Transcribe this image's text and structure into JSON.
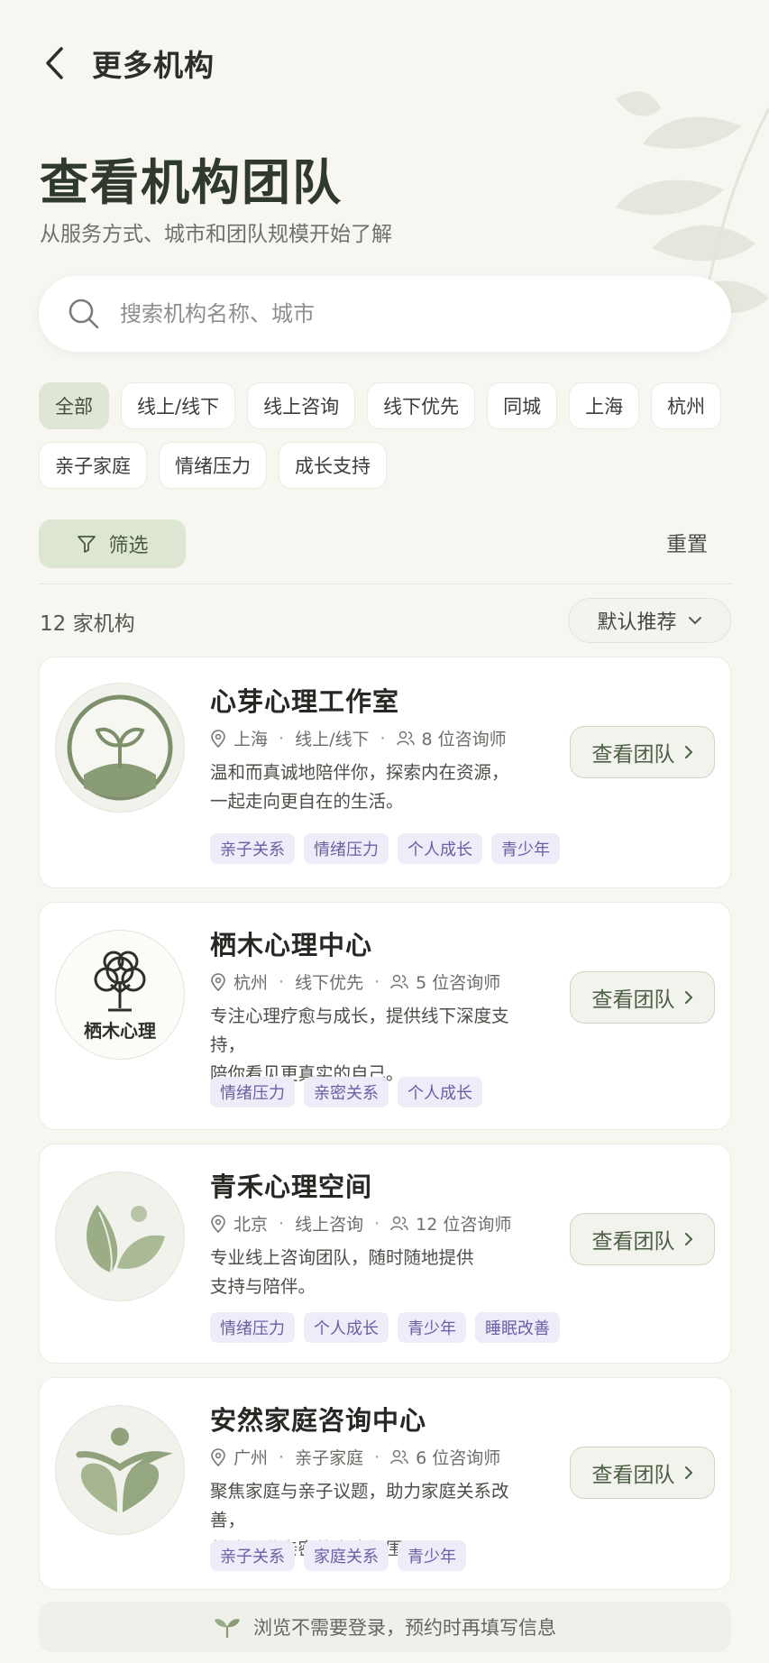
{
  "header": {
    "title": "更多机构"
  },
  "hero": {
    "title": "查看机构团队",
    "subtitle": "从服务方式、城市和团队规模开始了解"
  },
  "search": {
    "placeholder": "搜索机构名称、城市",
    "value": ""
  },
  "chips": [
    {
      "label": "全部",
      "active": true
    },
    {
      "label": "线上/线下"
    },
    {
      "label": "线上咨询"
    },
    {
      "label": "线下优先"
    },
    {
      "label": "同城"
    },
    {
      "label": "上海"
    },
    {
      "label": "杭州"
    },
    {
      "label": "亲子家庭"
    },
    {
      "label": "情绪压力"
    },
    {
      "label": "成长支持"
    }
  ],
  "filter": {
    "label": "筛选",
    "reset": "重置"
  },
  "results": {
    "count": "12 家机构",
    "sort": "默认推荐"
  },
  "orgs": [
    {
      "name": "心芽心理工作室",
      "city": "上海",
      "mode": "线上/线下",
      "counselors": "8 位咨询师",
      "desc": [
        "温和而真诚地陪伴你，探索内在资源，",
        "一起走向更自在的生活。"
      ],
      "tags": [
        "亲子关系",
        "情绪压力",
        "个人成长",
        "青少年"
      ],
      "button": "查看团队",
      "logo": "sprout-logo"
    },
    {
      "name": "栖木心理中心",
      "city": "杭州",
      "mode": "线下优先",
      "counselors": "5 位咨询师",
      "desc": [
        "专注心理疗愈与成长，提供线下深度支持，",
        "陪你看见更真实的自己。"
      ],
      "tags": [
        "情绪压力",
        "亲密关系",
        "个人成长"
      ],
      "button": "查看团队",
      "logo": "tree-logo",
      "logo_text": "栖木心理"
    },
    {
      "name": "青禾心理空间",
      "city": "北京",
      "mode": "线上咨询",
      "counselors": "12 位咨询师",
      "desc": [
        "专业线上咨询团队，随时随地提供",
        "支持与陪伴。"
      ],
      "tags": [
        "情绪压力",
        "个人成长",
        "青少年",
        "睡眠改善"
      ],
      "button": "查看团队",
      "logo": "leaf-logo"
    },
    {
      "name": "安然家庭咨询中心",
      "city": "广州",
      "mode": "亲子家庭",
      "counselors": "6 位咨询师",
      "desc": [
        "聚焦家庭与亲子议题，助力家庭关系改善，",
        "共建和谐亲密的家庭氛围。"
      ],
      "tags": [
        "亲子关系",
        "家庭关系",
        "青少年"
      ],
      "button": "查看团队",
      "logo": "heart-family-logo"
    }
  ],
  "footer": {
    "tip": "浏览不需要登录，预约时再填写信息"
  },
  "colors": {
    "accent": "#dde5d3",
    "tag_bg": "#eeecf8",
    "tag_text": "#6a5fa6",
    "logo_green": "#8a9c76"
  }
}
